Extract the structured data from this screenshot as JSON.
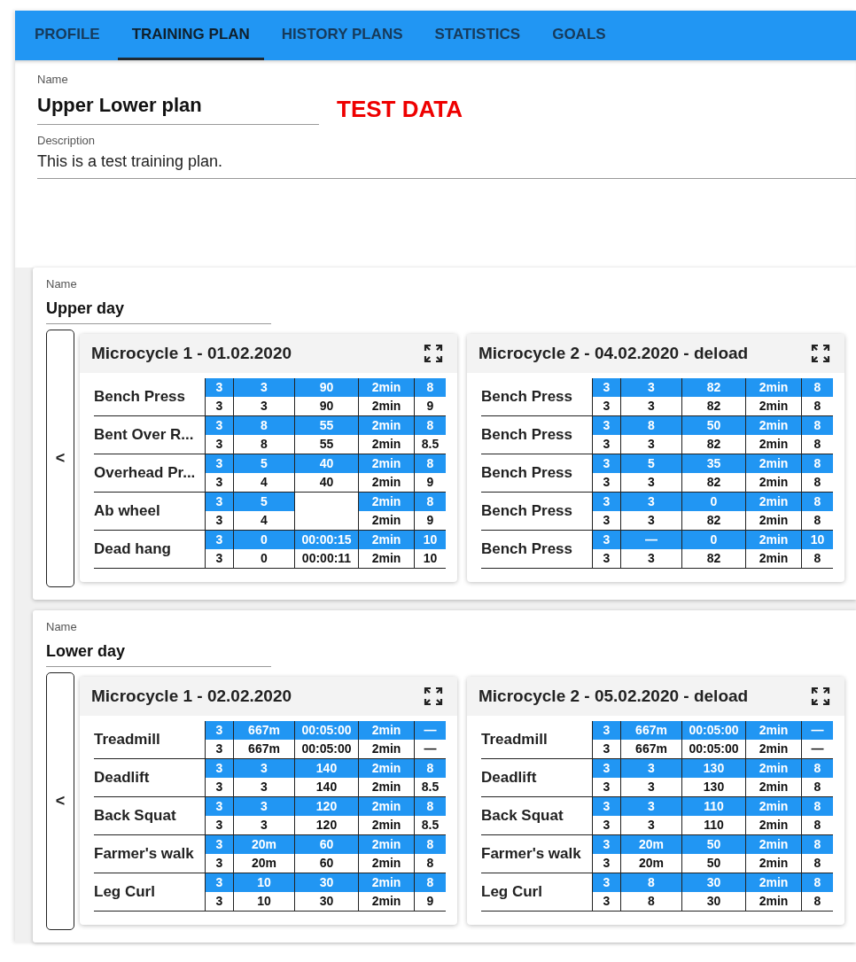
{
  "tabs": [
    {
      "label": "PROFILE",
      "selected": false
    },
    {
      "label": "TRAINING PLAN",
      "selected": true
    },
    {
      "label": "HISTORY PLANS",
      "selected": false
    },
    {
      "label": "STATISTICS",
      "selected": false
    },
    {
      "label": "GOALS",
      "selected": false
    }
  ],
  "plan": {
    "name_label": "Name",
    "name": "Upper Lower plan",
    "badge": "TEST DATA",
    "description_label": "Description",
    "description": "This is a test training plan."
  },
  "days": [
    {
      "name_label": "Name",
      "name": "Upper day",
      "prev": "<",
      "microcycles": [
        {
          "title": "Microcycle 1 - 01.02.2020",
          "exercises": [
            {
              "kind": "standard",
              "name": "Bench Press",
              "planned": [
                "3",
                "3",
                "90",
                "2min",
                "8"
              ],
              "actual": [
                "3",
                "3",
                "90",
                "2min",
                "9"
              ]
            },
            {
              "kind": "standard",
              "name": "Bent Over R...",
              "planned": [
                "3",
                "8",
                "55",
                "2min",
                "8"
              ],
              "actual": [
                "3",
                "8",
                "55",
                "2min",
                "8.5"
              ]
            },
            {
              "kind": "standard",
              "name": "Overhead Pr...",
              "planned": [
                "3",
                "5",
                "40",
                "2min",
                "8"
              ],
              "actual": [
                "3",
                "4",
                "40",
                "2min",
                "9"
              ]
            },
            {
              "kind": "no-weight",
              "name": "Ab wheel",
              "planned": [
                "3",
                "5",
                "2min",
                "8"
              ],
              "actual": [
                "3",
                "4",
                "2min",
                "9"
              ]
            },
            {
              "kind": "standard",
              "name": "Dead hang",
              "planned": [
                "3",
                "0",
                "00:00:15",
                "2min",
                "10"
              ],
              "actual": [
                "3",
                "0",
                "00:00:11",
                "2min",
                "10"
              ]
            }
          ]
        },
        {
          "title": "Microcycle 2 - 04.02.2020 - deload",
          "exercises": [
            {
              "kind": "standard",
              "name": "Bench Press",
              "planned": [
                "3",
                "3",
                "82",
                "2min",
                "8"
              ],
              "actual": [
                "3",
                "3",
                "82",
                "2min",
                "8"
              ]
            },
            {
              "kind": "standard",
              "name": "Bench Press",
              "planned": [
                "3",
                "8",
                "50",
                "2min",
                "8"
              ],
              "actual": [
                "3",
                "3",
                "82",
                "2min",
                "8"
              ]
            },
            {
              "kind": "standard",
              "name": "Bench Press",
              "planned": [
                "3",
                "5",
                "35",
                "2min",
                "8"
              ],
              "actual": [
                "3",
                "3",
                "82",
                "2min",
                "8"
              ]
            },
            {
              "kind": "standard",
              "name": "Bench Press",
              "planned": [
                "3",
                "3",
                "0",
                "2min",
                "8"
              ],
              "actual": [
                "3",
                "3",
                "82",
                "2min",
                "8"
              ]
            },
            {
              "kind": "standard",
              "name": "Bench Press",
              "planned": [
                "3",
                "—",
                "0",
                "2min",
                "10"
              ],
              "actual": [
                "3",
                "3",
                "82",
                "2min",
                "8"
              ]
            }
          ]
        }
      ]
    },
    {
      "name_label": "Name",
      "name": "Lower day",
      "prev": "<",
      "microcycles": [
        {
          "title": "Microcycle 1 - 02.02.2020",
          "exercises": [
            {
              "kind": "standard",
              "name": "Treadmill",
              "planned": [
                "3",
                "667m",
                "00:05:00",
                "2min",
                "—"
              ],
              "actual": [
                "3",
                "667m",
                "00:05:00",
                "2min",
                "—"
              ]
            },
            {
              "kind": "standard",
              "name": "Deadlift",
              "planned": [
                "3",
                "3",
                "140",
                "2min",
                "8"
              ],
              "actual": [
                "3",
                "3",
                "140",
                "2min",
                "8.5"
              ]
            },
            {
              "kind": "standard",
              "name": "Back Squat",
              "planned": [
                "3",
                "3",
                "120",
                "2min",
                "8"
              ],
              "actual": [
                "3",
                "3",
                "120",
                "2min",
                "8.5"
              ]
            },
            {
              "kind": "standard",
              "name": "Farmer's walk",
              "planned": [
                "3",
                "20m",
                "60",
                "2min",
                "8"
              ],
              "actual": [
                "3",
                "20m",
                "60",
                "2min",
                "8"
              ]
            },
            {
              "kind": "standard",
              "name": "Leg Curl",
              "planned": [
                "3",
                "10",
                "30",
                "2min",
                "8"
              ],
              "actual": [
                "3",
                "10",
                "30",
                "2min",
                "9"
              ]
            }
          ]
        },
        {
          "title": "Microcycle 2 - 05.02.2020 - deload",
          "exercises": [
            {
              "kind": "standard",
              "name": "Treadmill",
              "planned": [
                "3",
                "667m",
                "00:05:00",
                "2min",
                "—"
              ],
              "actual": [
                "3",
                "667m",
                "00:05:00",
                "2min",
                "—"
              ]
            },
            {
              "kind": "standard",
              "name": "Deadlift",
              "planned": [
                "3",
                "3",
                "130",
                "2min",
                "8"
              ],
              "actual": [
                "3",
                "3",
                "130",
                "2min",
                "8"
              ]
            },
            {
              "kind": "standard",
              "name": "Back Squat",
              "planned": [
                "3",
                "3",
                "110",
                "2min",
                "8"
              ],
              "actual": [
                "3",
                "3",
                "110",
                "2min",
                "8"
              ]
            },
            {
              "kind": "standard",
              "name": "Farmer's walk",
              "planned": [
                "3",
                "20m",
                "50",
                "2min",
                "8"
              ],
              "actual": [
                "3",
                "20m",
                "50",
                "2min",
                "8"
              ]
            },
            {
              "kind": "standard",
              "name": "Leg Curl",
              "planned": [
                "3",
                "8",
                "30",
                "2min",
                "8"
              ],
              "actual": [
                "3",
                "8",
                "30",
                "2min",
                "8"
              ]
            }
          ]
        }
      ]
    }
  ]
}
